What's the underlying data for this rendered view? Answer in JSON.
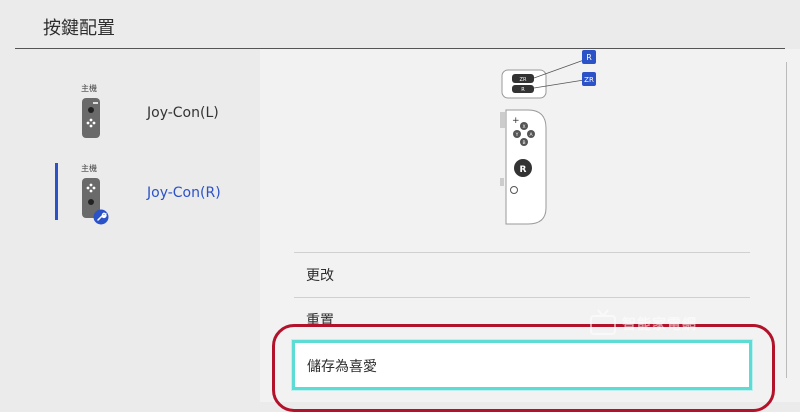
{
  "header": {
    "title": "按鍵配置"
  },
  "controllers": [
    {
      "mode": "主機",
      "label": "Joy-Con(L)",
      "selected": false
    },
    {
      "mode": "主機",
      "label": "Joy-Con(R)",
      "selected": true
    }
  ],
  "preview": {
    "buttons": [
      "R",
      "ZR",
      "X",
      "Y",
      "A",
      "B",
      "R",
      "+"
    ]
  },
  "menu": {
    "items": [
      {
        "label": "更改"
      },
      {
        "label": "重置"
      },
      {
        "label": "儲存為喜愛"
      }
    ]
  },
  "colors": {
    "accent": "#2b52c6",
    "highlight_border": "#5cdcd5",
    "annotation_ring": "#b3122b"
  },
  "watermark": {
    "text": "智能家電網"
  }
}
